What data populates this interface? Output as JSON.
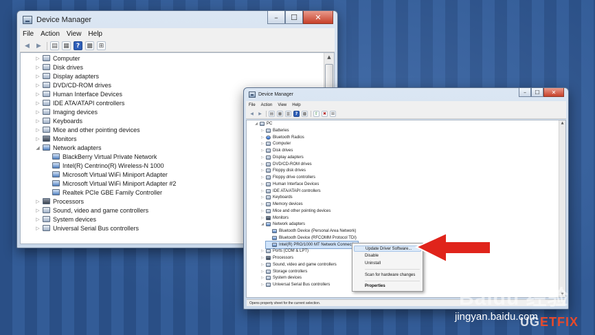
{
  "window1": {
    "title": "Device Manager",
    "menu": [
      "File",
      "Action",
      "View",
      "Help"
    ],
    "caption": {
      "minimize": "–",
      "maximize": "☐",
      "close": "✕"
    },
    "tree": [
      {
        "label": "Computer",
        "expander": "▷",
        "indent": 0,
        "icon": "computer-icon"
      },
      {
        "label": "Disk drives",
        "expander": "▷",
        "indent": 0,
        "icon": "disk-drive-icon"
      },
      {
        "label": "Display adapters",
        "expander": "▷",
        "indent": 0,
        "icon": "display-adapter-icon"
      },
      {
        "label": "DVD/CD-ROM drives",
        "expander": "▷",
        "indent": 0,
        "icon": "dvd-drive-icon"
      },
      {
        "label": "Human Interface Devices",
        "expander": "▷",
        "indent": 0,
        "icon": "hid-icon"
      },
      {
        "label": "IDE ATA/ATAPI controllers",
        "expander": "▷",
        "indent": 0,
        "icon": "ide-controller-icon"
      },
      {
        "label": "Imaging devices",
        "expander": "▷",
        "indent": 0,
        "icon": "camera-icon"
      },
      {
        "label": "Keyboards",
        "expander": "▷",
        "indent": 0,
        "icon": "keyboard-icon"
      },
      {
        "label": "Mice and other pointing devices",
        "expander": "▷",
        "indent": 0,
        "icon": "mouse-icon"
      },
      {
        "label": "Monitors",
        "expander": "▷",
        "indent": 0,
        "icon": "monitor-icon"
      },
      {
        "label": "Network adapters",
        "expander": "◢",
        "indent": 0,
        "icon": "network-adapter-icon"
      },
      {
        "label": "BlackBerry Virtual Private Network",
        "expander": "",
        "indent": 1,
        "icon": "network-adapter-icon"
      },
      {
        "label": "Intel(R) Centrino(R) Wireless-N 1000",
        "expander": "",
        "indent": 1,
        "icon": "network-adapter-icon"
      },
      {
        "label": "Microsoft Virtual WiFi Miniport Adapter",
        "expander": "",
        "indent": 1,
        "icon": "network-adapter-icon"
      },
      {
        "label": "Microsoft Virtual WiFi Miniport Adapter #2",
        "expander": "",
        "indent": 1,
        "icon": "network-adapter-icon"
      },
      {
        "label": "Realtek PCIe GBE Family Controller",
        "expander": "",
        "indent": 1,
        "icon": "network-adapter-icon"
      },
      {
        "label": "Processors",
        "expander": "▷",
        "indent": 0,
        "icon": "processor-icon"
      },
      {
        "label": "Sound, video and game controllers",
        "expander": "▷",
        "indent": 0,
        "icon": "speaker-icon"
      },
      {
        "label": "System devices",
        "expander": "▷",
        "indent": 0,
        "icon": "system-device-icon"
      },
      {
        "label": "Universal Serial Bus controllers",
        "expander": "▷",
        "indent": 0,
        "icon": "usb-icon"
      }
    ]
  },
  "window2": {
    "title": "Device Manager",
    "menu": [
      "File",
      "Action",
      "View",
      "Help"
    ],
    "caption": {
      "minimize": "–",
      "maximize": "☐",
      "close": "✕"
    },
    "status": "Opens property sheet for the current selection.",
    "tree": [
      {
        "label": "PC",
        "expander": "◢",
        "indent": 0,
        "icon": "computer-icon"
      },
      {
        "label": "Batteries",
        "expander": "▷",
        "indent": 1,
        "icon": "battery-icon"
      },
      {
        "label": "Bluetooth Radios",
        "expander": "▷",
        "indent": 1,
        "icon": "bluetooth-icon"
      },
      {
        "label": "Computer",
        "expander": "▷",
        "indent": 1,
        "icon": "computer-icon"
      },
      {
        "label": "Disk drives",
        "expander": "▷",
        "indent": 1,
        "icon": "disk-drive-icon"
      },
      {
        "label": "Display adapters",
        "expander": "▷",
        "indent": 1,
        "icon": "display-adapter-icon"
      },
      {
        "label": "DVD/CD-ROM drives",
        "expander": "▷",
        "indent": 1,
        "icon": "dvd-drive-icon"
      },
      {
        "label": "Floppy disk drives",
        "expander": "▷",
        "indent": 1,
        "icon": "floppy-drive-icon"
      },
      {
        "label": "Floppy drive controllers",
        "expander": "▷",
        "indent": 1,
        "icon": "floppy-controller-icon"
      },
      {
        "label": "Human Interface Devices",
        "expander": "▷",
        "indent": 1,
        "icon": "hid-icon"
      },
      {
        "label": "IDE ATA/ATAPI controllers",
        "expander": "▷",
        "indent": 1,
        "icon": "ide-controller-icon"
      },
      {
        "label": "Keyboards",
        "expander": "▷",
        "indent": 1,
        "icon": "keyboard-icon"
      },
      {
        "label": "Memory devices",
        "expander": "▷",
        "indent": 1,
        "icon": "memory-icon"
      },
      {
        "label": "Mice and other pointing devices",
        "expander": "▷",
        "indent": 1,
        "icon": "mouse-icon"
      },
      {
        "label": "Monitors",
        "expander": "▷",
        "indent": 1,
        "icon": "monitor-icon"
      },
      {
        "label": "Network adapters",
        "expander": "◢",
        "indent": 1,
        "icon": "network-adapter-icon"
      },
      {
        "label": "Bluetooth Device (Personal Area Network)",
        "expander": "",
        "indent": 2,
        "icon": "network-adapter-icon"
      },
      {
        "label": "Bluetooth Device (RFCOMM Protocol TDI)",
        "expander": "",
        "indent": 2,
        "icon": "network-adapter-icon"
      },
      {
        "label": "Intel(R) PRO/1000 MT Network Connection",
        "expander": "",
        "indent": 2,
        "icon": "network-adapter-icon",
        "selected": true
      },
      {
        "label": "Ports (COM & LPT)",
        "expander": "▷",
        "indent": 1,
        "icon": "port-icon"
      },
      {
        "label": "Processors",
        "expander": "▷",
        "indent": 1,
        "icon": "processor-icon"
      },
      {
        "label": "Sound, video and game controllers",
        "expander": "▷",
        "indent": 1,
        "icon": "speaker-icon"
      },
      {
        "label": "Storage controllers",
        "expander": "▷",
        "indent": 1,
        "icon": "storage-controller-icon"
      },
      {
        "label": "System devices",
        "expander": "▷",
        "indent": 1,
        "icon": "system-device-icon"
      },
      {
        "label": "Universal Serial Bus controllers",
        "expander": "▷",
        "indent": 1,
        "icon": "usb-icon"
      }
    ]
  },
  "context_menu": {
    "update_driver": "Update Driver Software...",
    "disable": "Disable",
    "uninstall": "Uninstall",
    "scan": "Scan for hardware changes",
    "properties": "Properties"
  },
  "watermarks": {
    "baidu": "Baidu 经验",
    "url": "jingyan.baidu.com",
    "brand_part1": "UG",
    "brand_part2": "ETFIX"
  },
  "colors": {
    "accent_arrow": "#e0241b",
    "selection": "#cfe3fb"
  }
}
